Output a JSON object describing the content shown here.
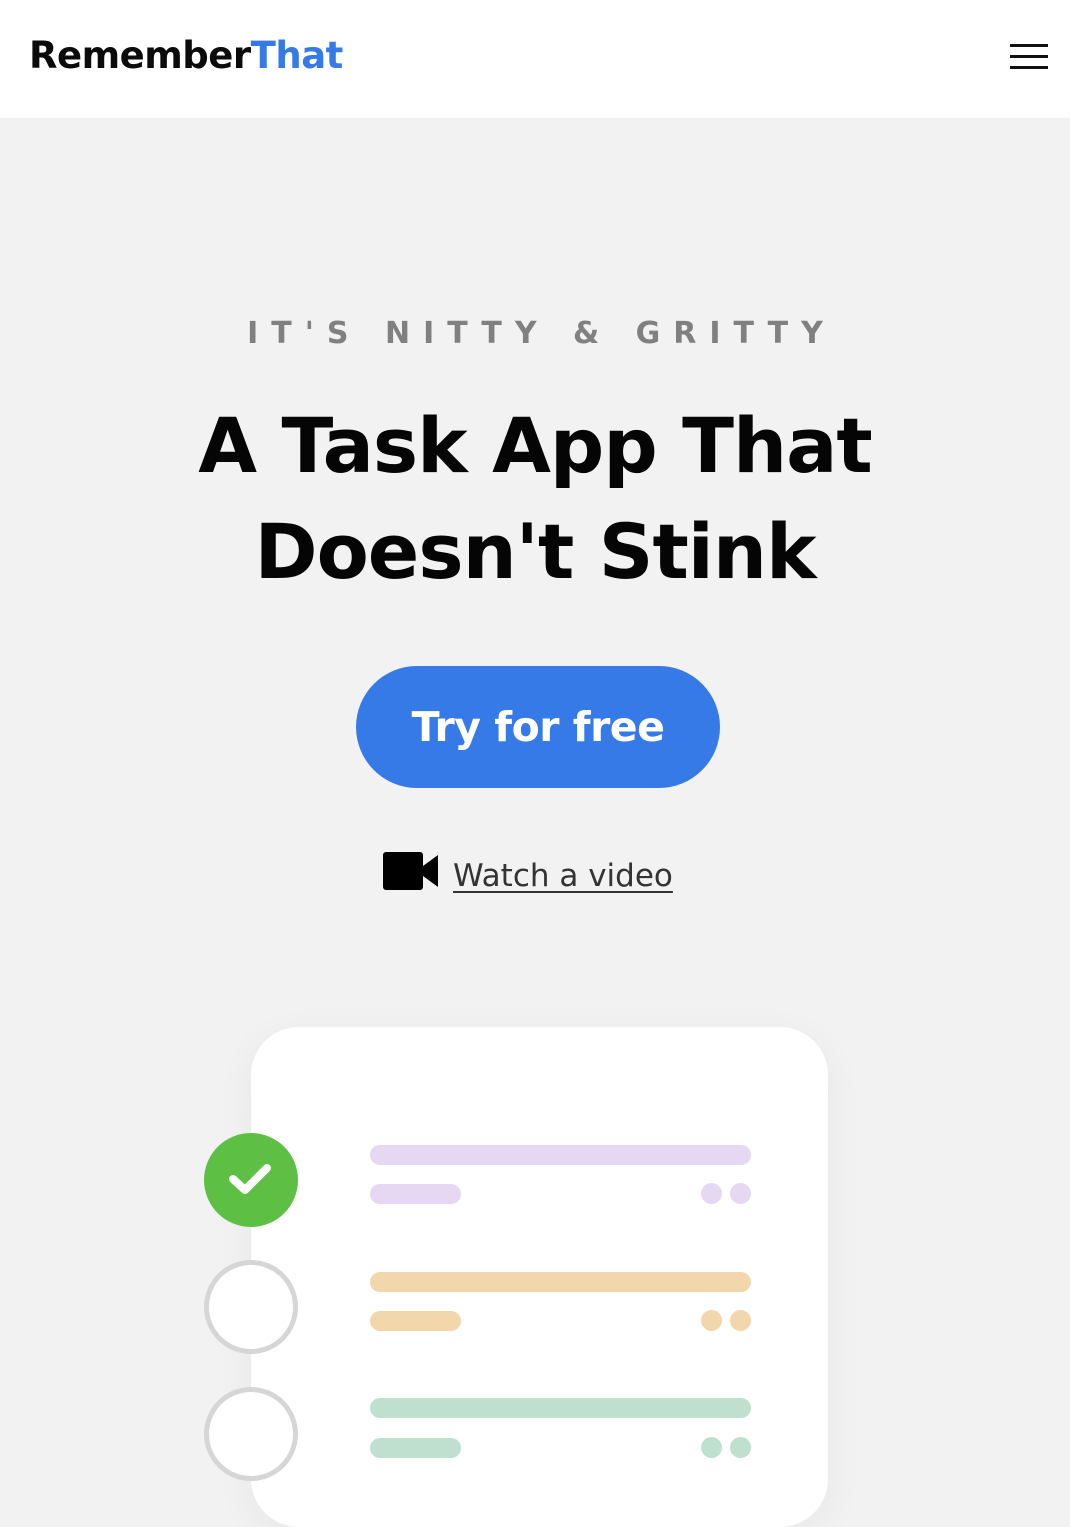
{
  "header": {
    "logo_primary": "Remember",
    "logo_accent": "That",
    "menu_icon": "hamburger-menu-icon"
  },
  "hero": {
    "eyebrow": "IT'S NITTY & GRITTY",
    "headline_line1": "A Task App That",
    "headline_line2": "Doesn't Stink",
    "cta_label": "Try for free",
    "video_icon": "video-camera-icon",
    "video_label": " Watch a video"
  },
  "illustration": {
    "tasks": [
      {
        "status": "completed",
        "color": "#e6d7f2",
        "icon": "checkmark-icon"
      },
      {
        "status": "incomplete",
        "color": "#f2d7ad"
      },
      {
        "status": "incomplete",
        "color": "#bfdfcf"
      }
    ]
  },
  "colors": {
    "brand_blue": "#367ae8",
    "check_green": "#5dc044",
    "background": "#f2f2f2"
  }
}
